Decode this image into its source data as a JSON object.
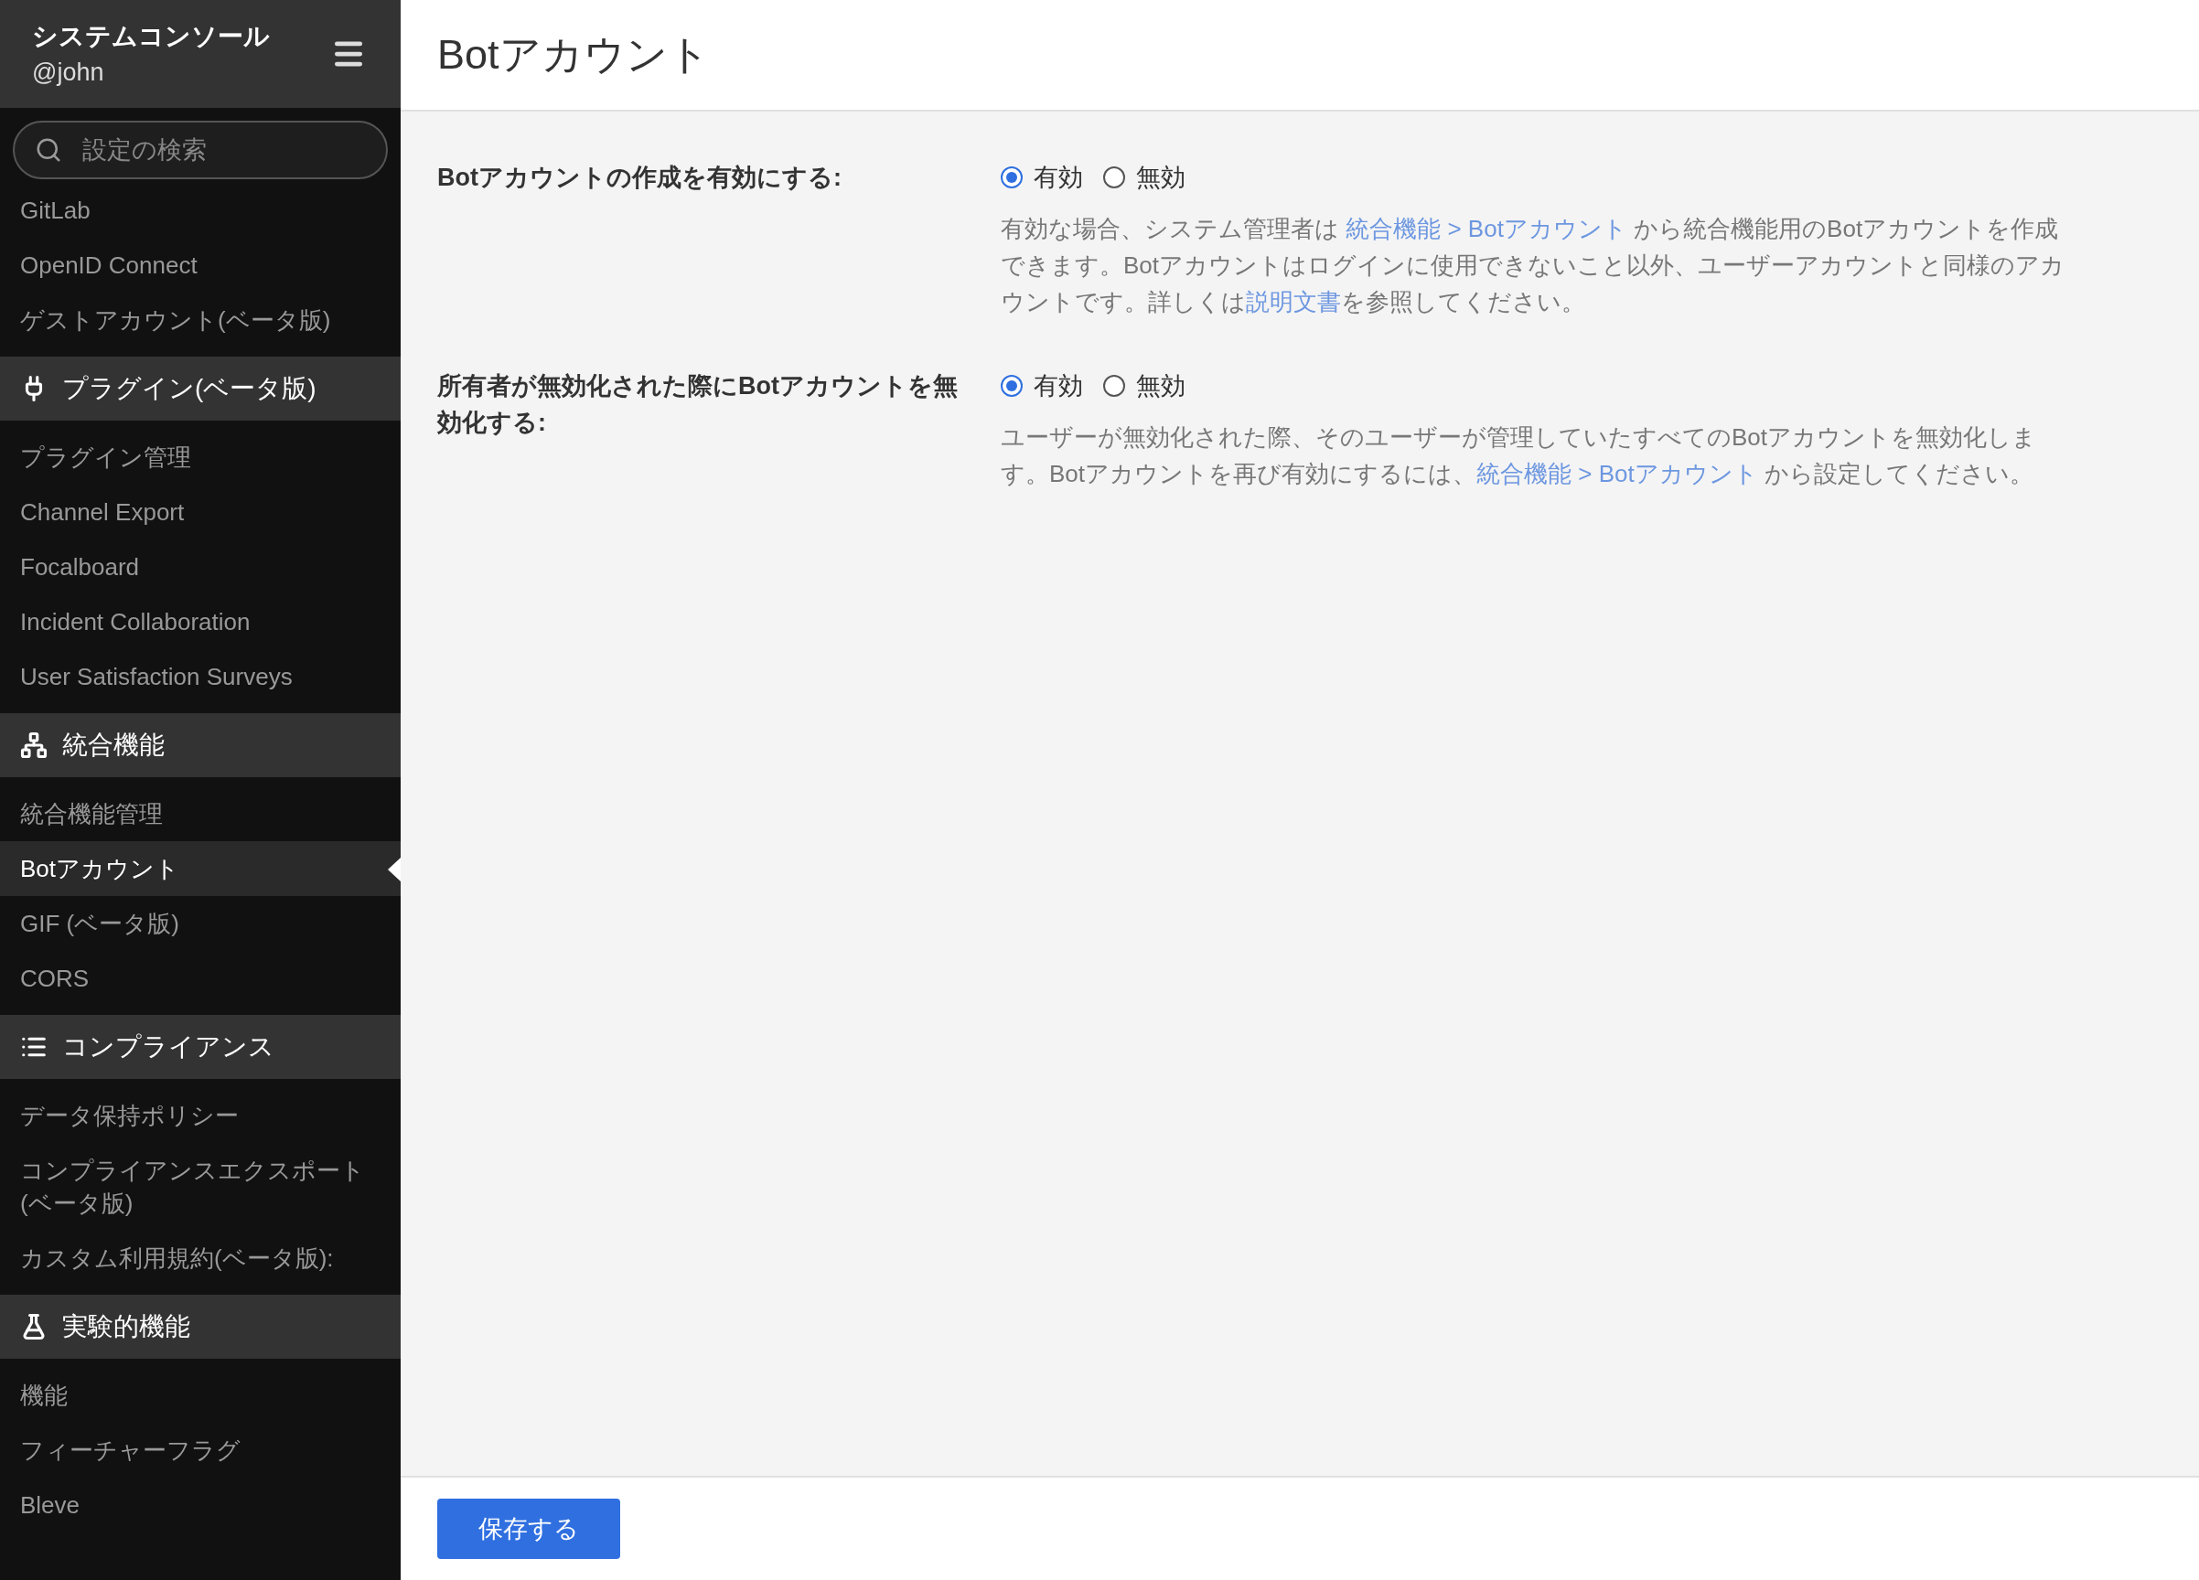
{
  "sidebar": {
    "title": "システムコンソール",
    "user": "@john",
    "search": {
      "placeholder": "設定の検索"
    },
    "groups": [
      {
        "items": [
          {
            "label": "GitLab",
            "selected": false
          },
          {
            "label": "OpenID Connect",
            "selected": false
          },
          {
            "label": "ゲストアカウント(ベータ版)",
            "selected": false
          }
        ]
      },
      {
        "title": "プラグイン(ベータ版)",
        "kind": "plugin",
        "items": [
          {
            "label": "プラグイン管理",
            "selected": false
          },
          {
            "label": "Channel Export",
            "selected": false
          },
          {
            "label": "Focalboard",
            "selected": false
          },
          {
            "label": "Incident Collaboration",
            "selected": false
          },
          {
            "label": "User Satisfaction Surveys",
            "selected": false
          }
        ]
      },
      {
        "title": "統合機能",
        "kind": "sitemap",
        "items": [
          {
            "label": "統合機能管理",
            "selected": false
          },
          {
            "label": "Botアカウント",
            "selected": true
          },
          {
            "label": "GIF (ベータ版)",
            "selected": false
          },
          {
            "label": "CORS",
            "selected": false
          }
        ]
      },
      {
        "title": "コンプライアンス",
        "kind": "list",
        "items": [
          {
            "label": "データ保持ポリシー",
            "selected": false
          },
          {
            "label": "コンプライアンスエクスポート (ベータ版)",
            "selected": false
          },
          {
            "label": "カスタム利用規約(ベータ版):",
            "selected": false
          }
        ]
      },
      {
        "title": "実験的機能",
        "kind": "flask",
        "items": [
          {
            "label": "機能",
            "selected": false
          },
          {
            "label": "フィーチャーフラグ",
            "selected": false
          },
          {
            "label": "Bleve",
            "selected": false
          }
        ]
      }
    ]
  },
  "page": {
    "title": "Botアカウント",
    "settings": [
      {
        "label": "Botアカウントの作成を有効にする:",
        "options": [
          {
            "label": "有効",
            "selected": true
          },
          {
            "label": "無効",
            "selected": false
          }
        ],
        "help": [
          {
            "kind": "text",
            "text": "有効な場合、システム管理者は "
          },
          {
            "kind": "link",
            "text": "統合機能 > Botアカウント"
          },
          {
            "kind": "text",
            "text": " から統合機能用のBotアカウントを作成できます。Botアカウントはログインに使用できないこと以外、ユーザーアカウントと同様のアカウントです。詳しくは"
          },
          {
            "kind": "link",
            "text": "説明文書"
          },
          {
            "kind": "text",
            "text": "を参照してください。"
          }
        ]
      },
      {
        "label": "所有者が無効化された際にBotアカウントを無効化する:",
        "options": [
          {
            "label": "有効",
            "selected": true
          },
          {
            "label": "無効",
            "selected": false
          }
        ],
        "help": [
          {
            "kind": "text",
            "text": "ユーザーが無効化された際、そのユーザーが管理していたすべてのBotアカウントを無効化します。Botアカウントを再び有効にするには、"
          },
          {
            "kind": "link",
            "text": "統合機能 > Botアカウント"
          },
          {
            "kind": "text",
            "text": " から設定してください。"
          }
        ]
      }
    ],
    "save_button": "保存する"
  }
}
